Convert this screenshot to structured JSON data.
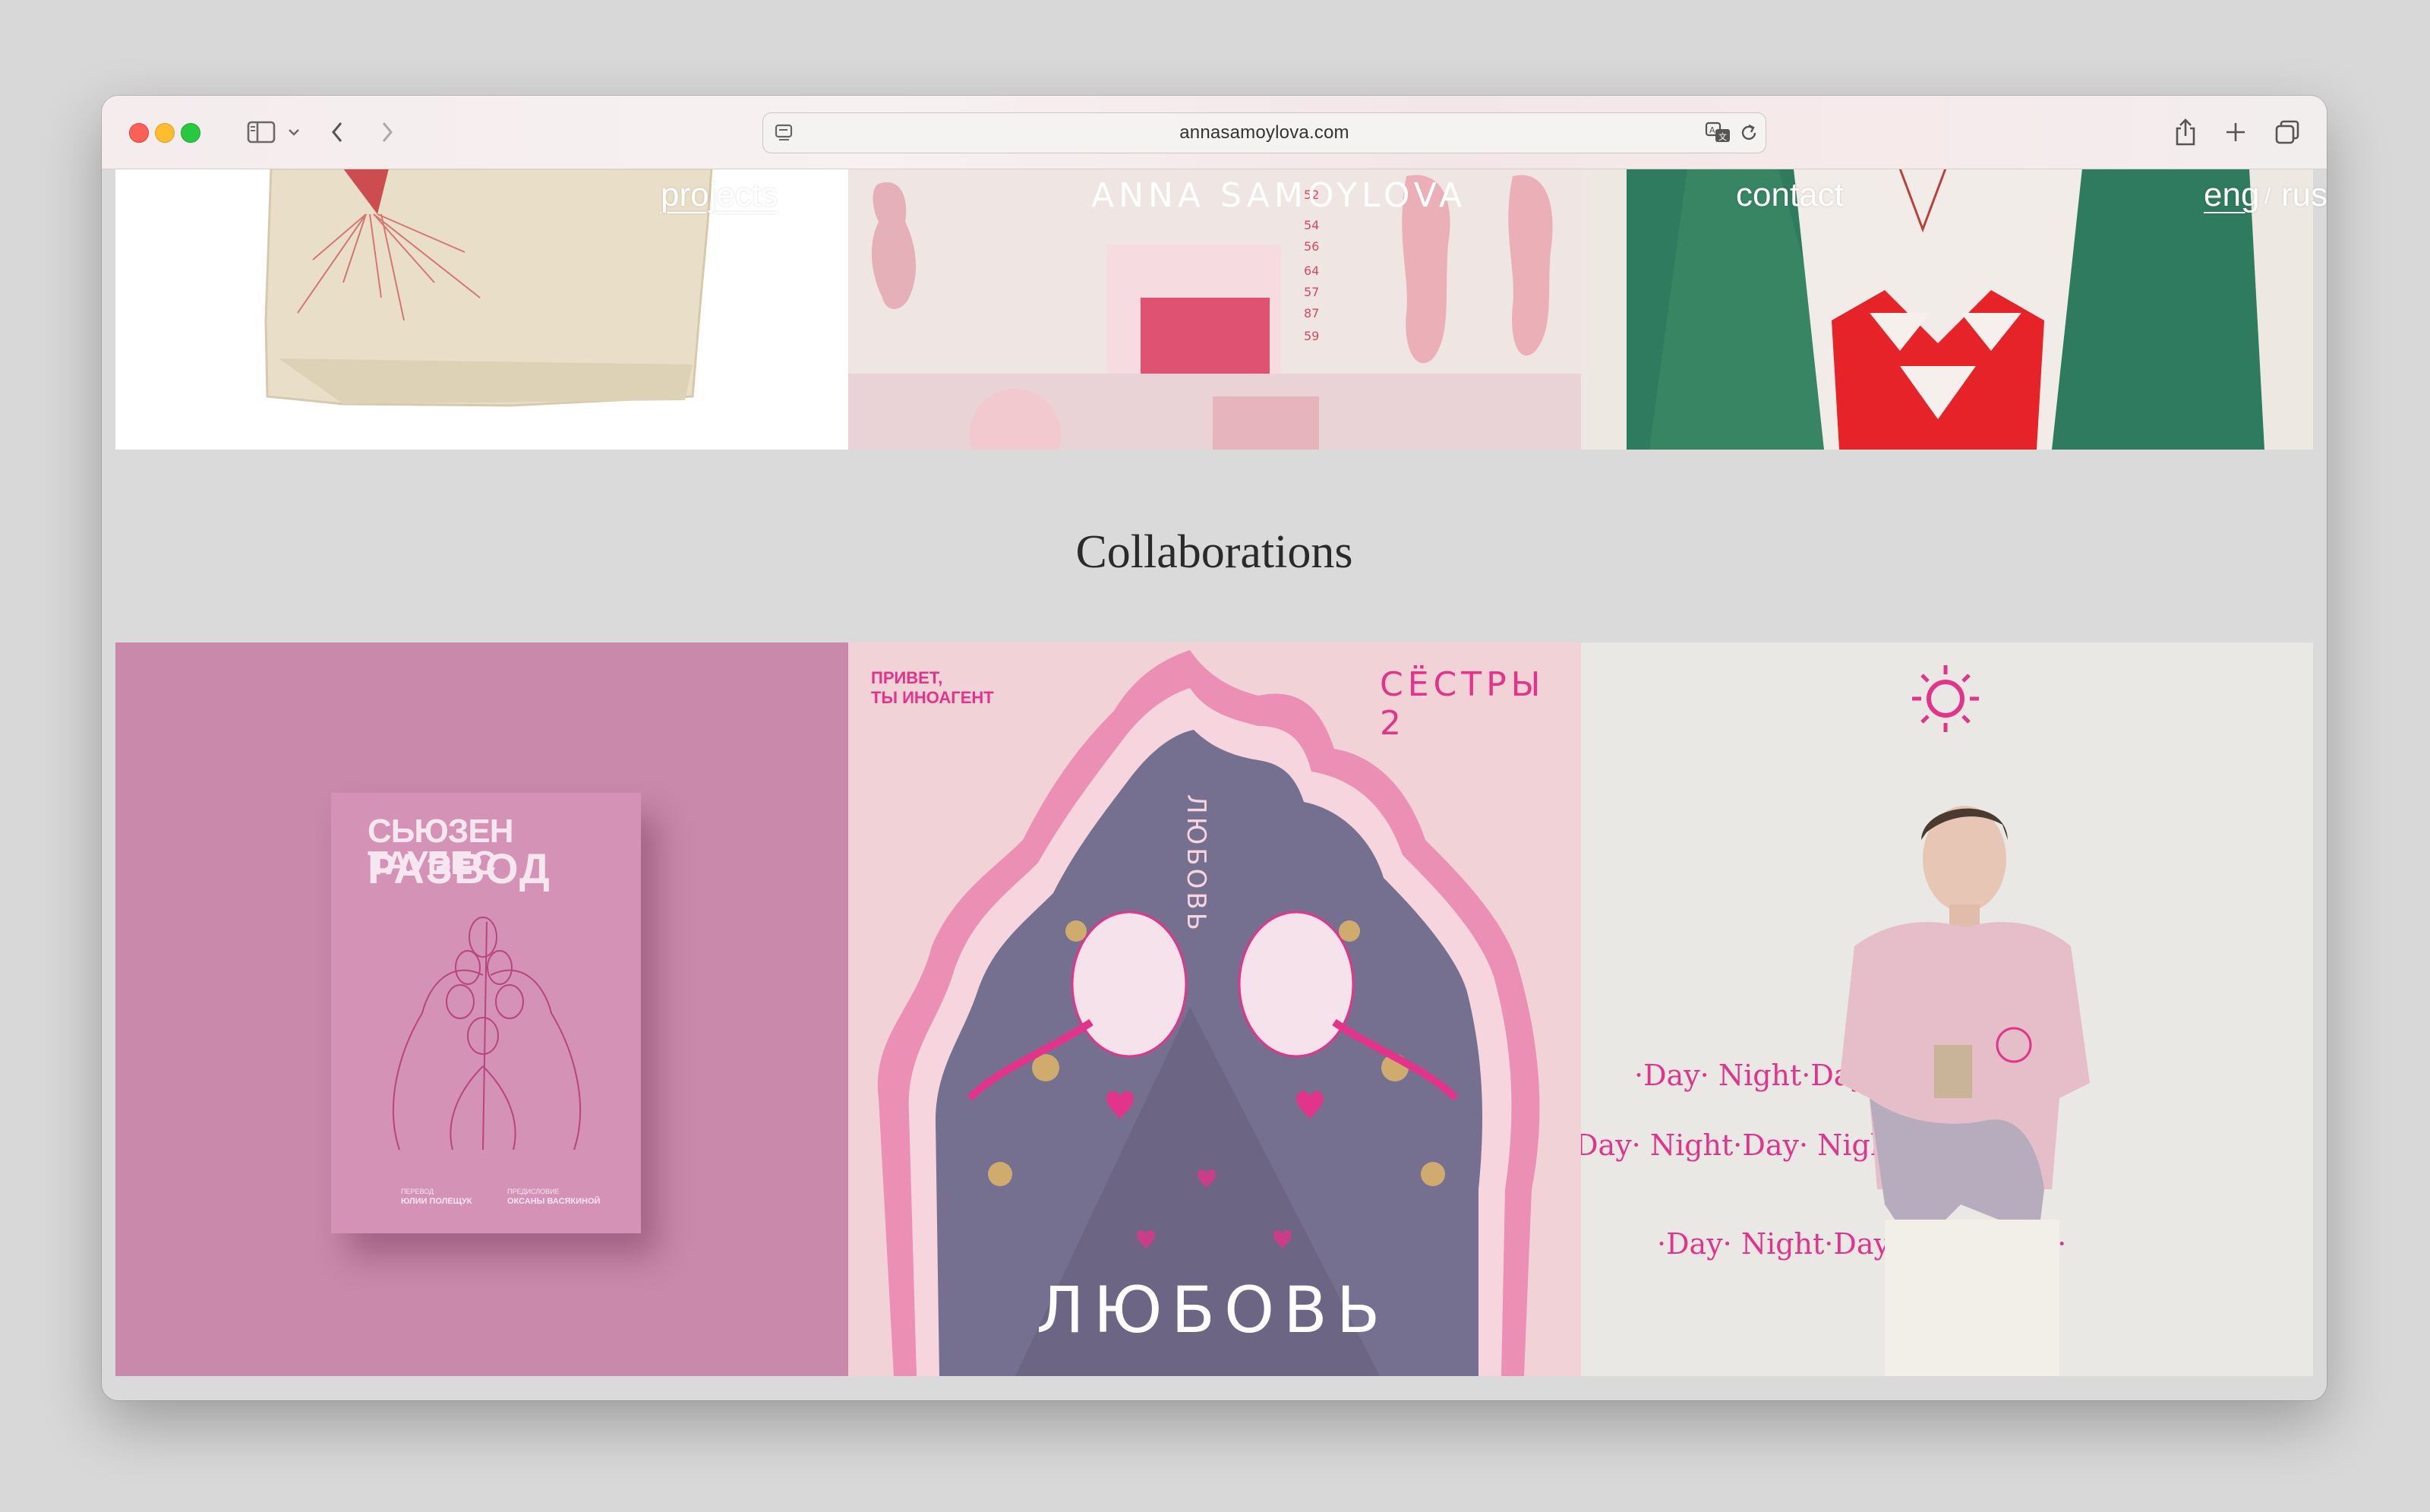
{
  "browser": {
    "url": "annasamoylova.com"
  },
  "site_nav": {
    "projects": "projects",
    "logo": "ANNA SAMOYLOVA",
    "contact": "contact",
    "lang_eng": "eng",
    "lang_sep": "/",
    "lang_rus": "rus"
  },
  "collaborations": {
    "title": "Collaborations",
    "book": {
      "author_title": "СЬЮЗЕН ТАУБЕС",
      "book_title": "РАЗВОД",
      "translator_label": "ПЕРЕВОД",
      "translator": "ЮЛИИ ПОЛЕЩУК",
      "foreword_label": "ПРЕДИСЛОВИЕ",
      "foreword": "ОКСАНЫ ВАСЯКИНОЙ"
    },
    "poster": {
      "top_left_line1": "ПРИВЕТ,",
      "top_left_line2": "ТЫ ИНОАГЕНТ",
      "top_right": "СЁСТРЫ 2",
      "inner_word": "ЛЮБОВЬ",
      "bottom_word": "ЛЮБОВЬ"
    },
    "fashion": {
      "pattern_line": "·Day· Night·Day· Night·Day·"
    }
  },
  "colors": {
    "accent_pink": "#e2348a",
    "book_pink": "#d38fb5",
    "poster_violet": "#6c6584"
  },
  "icons": {
    "sidebar": "sidebar-icon",
    "back": "chevron-left-icon",
    "forward": "chevron-right-icon",
    "translate": "translate-icon",
    "reload": "reload-icon",
    "share": "share-icon",
    "new_tab": "plus-icon",
    "tabs": "tabs-overview-icon"
  }
}
